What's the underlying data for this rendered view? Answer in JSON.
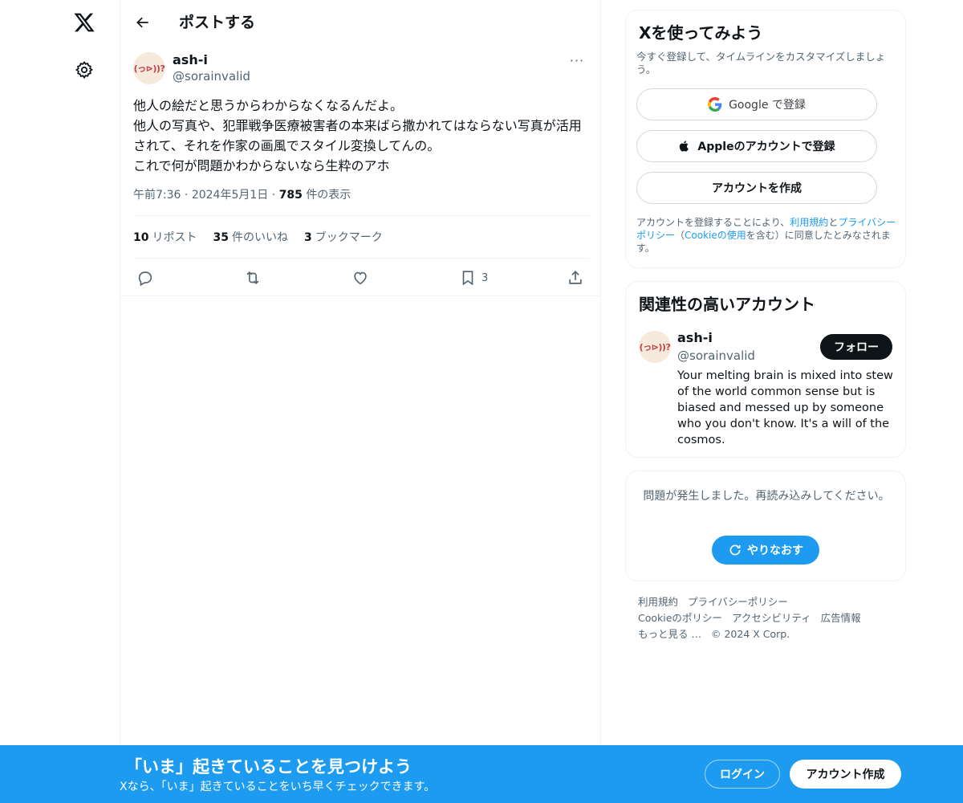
{
  "nav": {
    "logo": "x-logo-icon",
    "settings": "gear-icon"
  },
  "header": {
    "title": "ポストする"
  },
  "post": {
    "author_name": "ash-i",
    "author_handle": "@sorainvalid",
    "avatar_text": "(っ⊳))?",
    "more": "···",
    "text": "他人の絵だと思うからわからなくなるんだよ。\n他人の写真や、犯罪戦争医療被害者の本来ばら撒かれてはならない写真が活用されて、それを作家の画風でスタイル変換してんの。\nこれで何が問題かわからないなら生粋のアホ",
    "time": "午前7:36",
    "date": "2024年5月1日",
    "views_count": "785",
    "views_label": "件の表示",
    "stats": {
      "reposts_count": "10",
      "reposts_label": "リポスト",
      "likes_count": "35",
      "likes_label": "件のいいね",
      "bookmarks_count": "3",
      "bookmarks_label": "ブックマーク"
    },
    "actions": {
      "bookmark_count": "3"
    }
  },
  "signup_card": {
    "title": "Xを使ってみよう",
    "subtitle": "今すぐ登録して、タイムラインをカスタマイズしましょう。",
    "google_label": "Google で登録",
    "apple_label": "Appleのアカウントで登録",
    "create_label": "アカウントを作成",
    "terms_prefix": "アカウントを登録することにより、",
    "terms_link1": "利用規約",
    "terms_and": "と",
    "terms_link2": "プライバシーポリシー",
    "terms_mid": "（",
    "terms_link3": "Cookieの使用",
    "terms_suffix": "を含む）に同意したとみなされます。"
  },
  "related": {
    "title": "関連性の高いアカウント",
    "name": "ash-i",
    "handle": "@sorainvalid",
    "avatar_text": "(っ⊳))?",
    "follow_label": "フォロー",
    "bio": "Your melting brain is mixed into stew of the world common sense but is biased and messed up by someone who you don't know. It's a will of the cosmos."
  },
  "error_card": {
    "message": "問題が発生しました。再読み込みしてください。",
    "retry_label": "やりなおす"
  },
  "footer": {
    "terms": "利用規約",
    "privacy": "プライバシーポリシー",
    "cookie": "Cookieのポリシー",
    "accessibility": "アクセシビリティ",
    "ads": "広告情報",
    "more": "もっと見る …",
    "copyright": "© 2024 X Corp."
  },
  "banner": {
    "title": "「いま」起きていることを見つけよう",
    "subtitle": "Xなら、「いま」起きていることをいち早くチェックできます。",
    "login_label": "ログイン",
    "signup_label": "アカウント作成"
  },
  "colors": {
    "accent": "#1d9bf0",
    "text": "#0f1419",
    "muted": "#536471",
    "border": "#eff3f4"
  }
}
